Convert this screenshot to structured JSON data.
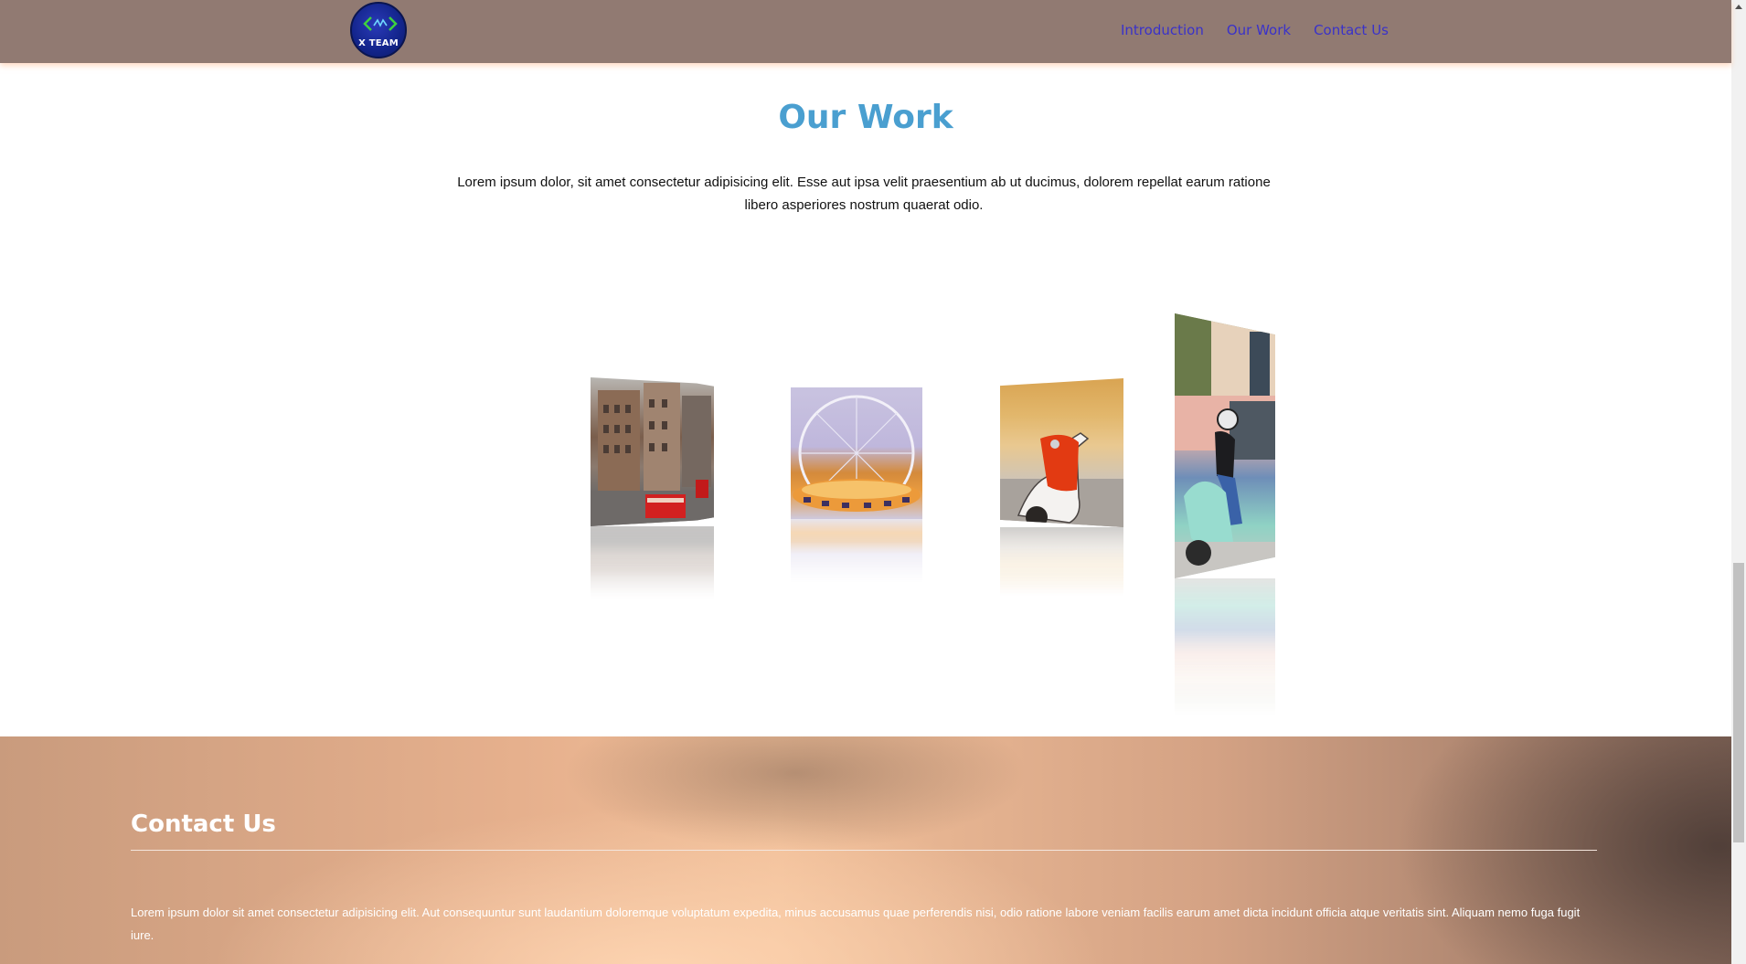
{
  "brand": {
    "logo_text": "X TEAM",
    "logo_icon": "code-brackets-icon"
  },
  "nav": {
    "items": [
      "Introduction",
      "Our Work",
      "Contact Us"
    ],
    "link_color": "#3a32c9",
    "bar_color": "#917a72"
  },
  "work": {
    "title": "Our Work",
    "description": "Lorem ipsum dolor, sit amet consectetur adipisicing elit. Esse aut ipsa velit praesentium ab ut ducimus, dolorem repellat earum ratione libero asperiores nostrum quaerat odio.",
    "title_color": "#4a9fd0",
    "gallery": [
      "city-street-photo",
      "ferris-wheel-photo",
      "scooter-photo",
      "rider-on-scooter-photo"
    ]
  },
  "contact": {
    "title": "Contact Us",
    "text": "Lorem ipsum dolor sit amet consectetur adipisicing elit. Aut consequuntur sunt laudantium doloremque voluptatum expedita, minus accusamus quae perferendis nisi, odio ratione labore veniam facilis earum amet dicta incidunt officia atque veritatis sint. Aliquam nemo fuga fugit iure."
  }
}
